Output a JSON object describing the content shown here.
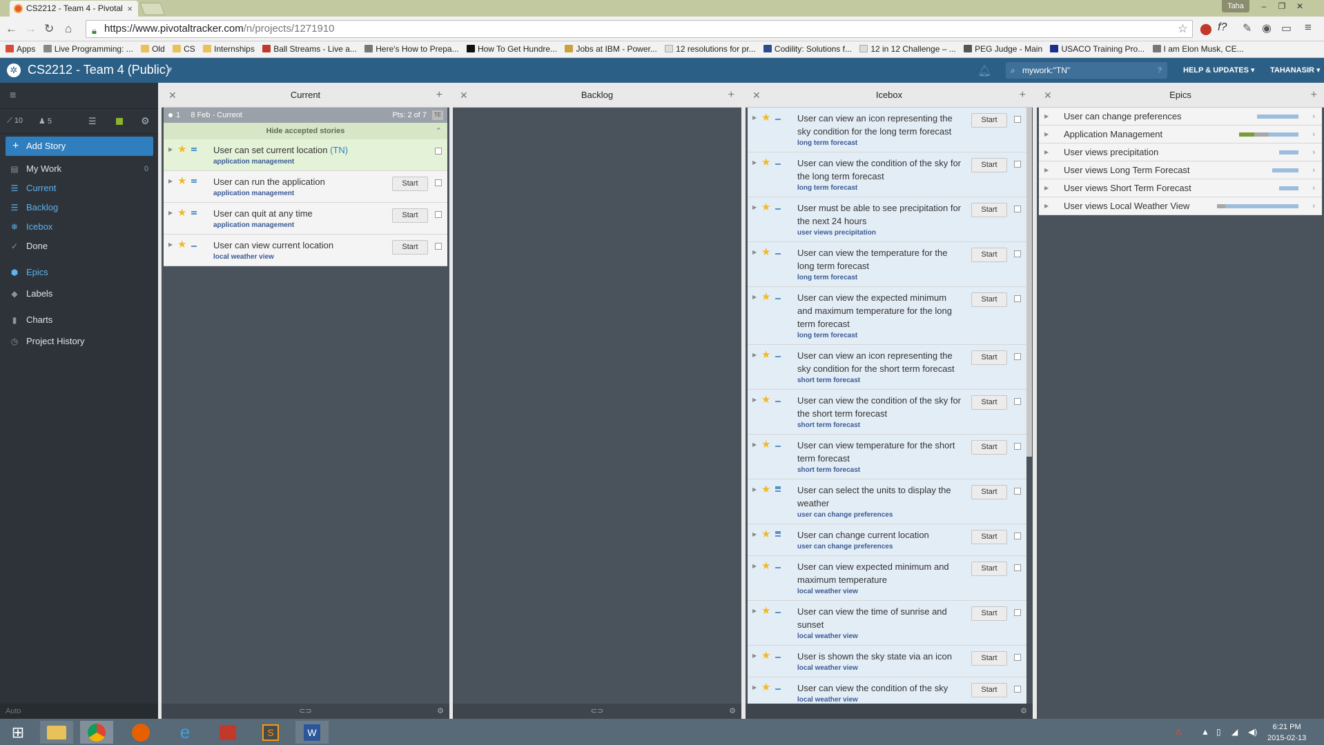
{
  "browser": {
    "tab_title": "CS2212 - Team 4 - Pivotal",
    "tab_close": "×",
    "profile": "Taha",
    "url_host": "https://www.pivotaltracker.com",
    "url_path": "/n/projects/1271910",
    "bookmarks": [
      "Apps",
      "Live Programming: ...",
      "Old",
      "CS",
      "Internships",
      "Ball Streams - Live a...",
      "Here's How to Prepa...",
      "How To Get Hundre...",
      "Jobs at IBM - Power...",
      "12 resolutions for pr...",
      "Codility: Solutions f...",
      "12 in 12 Challenge – ...",
      "PEG Judge - Main",
      "USACO Training Pro...",
      "I am Elon Musk, CE..."
    ]
  },
  "app": {
    "project_title": "CS2212 - Team 4 (Public)",
    "search_value": "mywork:\"TN\"",
    "search_help": "?",
    "help_label": "HELP & UPDATES",
    "user_label": "TAHANASIR"
  },
  "sidebar": {
    "velocity": "10",
    "members": "5",
    "add_story": "Add Story",
    "items": [
      {
        "label": "My Work",
        "count": "0"
      },
      {
        "label": "Current"
      },
      {
        "label": "Backlog"
      },
      {
        "label": "Icebox"
      },
      {
        "label": "Done"
      },
      {
        "label": "Epics"
      },
      {
        "label": "Labels"
      },
      {
        "label": "Charts"
      },
      {
        "label": "Project History"
      }
    ],
    "footer": "Auto"
  },
  "panels": {
    "current": {
      "title": "Current",
      "iteration_number": "1",
      "iteration_label": "8 Feb - Current",
      "points": "Pts: 2 of 7",
      "te": "TE",
      "hide_accepted": "Hide accepted stories",
      "stories": [
        {
          "title": "User can set current location ",
          "owner": "(TN)",
          "label": "application management",
          "start": ""
        },
        {
          "title": "User can run the application",
          "label": "application management",
          "start": "Start"
        },
        {
          "title": "User can quit at any time",
          "label": "application management",
          "start": "Start"
        },
        {
          "title": "User can view current location",
          "label": "local weather view",
          "start": "Start"
        }
      ]
    },
    "backlog": {
      "title": "Backlog"
    },
    "icebox": {
      "title": "Icebox",
      "stories": [
        {
          "title": "User can view an icon representing the sky condition for the long term forecast",
          "label": "long term forecast",
          "start": "Start"
        },
        {
          "title": "User can view the condition of the sky for the long term forecast",
          "label": "long term forecast",
          "start": "Start"
        },
        {
          "title": "User must be able to see precipitation for the next 24 hours",
          "label": "user views precipitation",
          "start": "Start"
        },
        {
          "title": "User can view the temperature for the long term forecast",
          "label": "long term forecast",
          "start": "Start"
        },
        {
          "title": "User can view the expected minimum and maximum temperature for the long term forecast",
          "label": "long term forecast",
          "start": "Start"
        },
        {
          "title": "User can view an icon representing the sky condition for the short term forecast",
          "label": "short term forecast",
          "start": "Start"
        },
        {
          "title": "User can view the condition of the sky for the short term forecast",
          "label": "short term forecast",
          "start": "Start"
        },
        {
          "title": "User can view temperature for the short term forecast",
          "label": "short term forecast",
          "start": "Start"
        },
        {
          "title": "User can select the units to display the weather",
          "label": "user can change preferences",
          "start": "Start"
        },
        {
          "title": "User can change current location",
          "label": "user can change preferences",
          "start": "Start"
        },
        {
          "title": "User can view expected minimum and maximum temperature",
          "label": "local weather view",
          "start": "Start"
        },
        {
          "title": "User can view the time of sunrise and sunset",
          "label": "local weather view",
          "start": "Start"
        },
        {
          "title": "User is shown the sky state via an icon",
          "label": "local weather view",
          "start": "Start"
        },
        {
          "title": "User can view the condition of the sky",
          "label": "local weather view",
          "start": "Start"
        }
      ]
    },
    "epics": {
      "title": "Epics",
      "items": [
        {
          "name": "User can change preferences",
          "progress_done": 0,
          "progress_started": 0
        },
        {
          "name": "Application Management",
          "progress_done": 0.25,
          "progress_started": 0.5
        },
        {
          "name": "User views precipitation",
          "progress_done": 0,
          "progress_started": 0
        },
        {
          "name": "User views Long Term Forecast",
          "progress_done": 0,
          "progress_started": 0
        },
        {
          "name": "User views Short Term Forecast",
          "progress_done": 0,
          "progress_started": 0
        },
        {
          "name": "User views Local Weather View",
          "progress_done": 0,
          "progress_started": 0.1
        }
      ]
    }
  },
  "taskbar": {
    "time": "6:21 PM",
    "date": "2015-02-13"
  }
}
